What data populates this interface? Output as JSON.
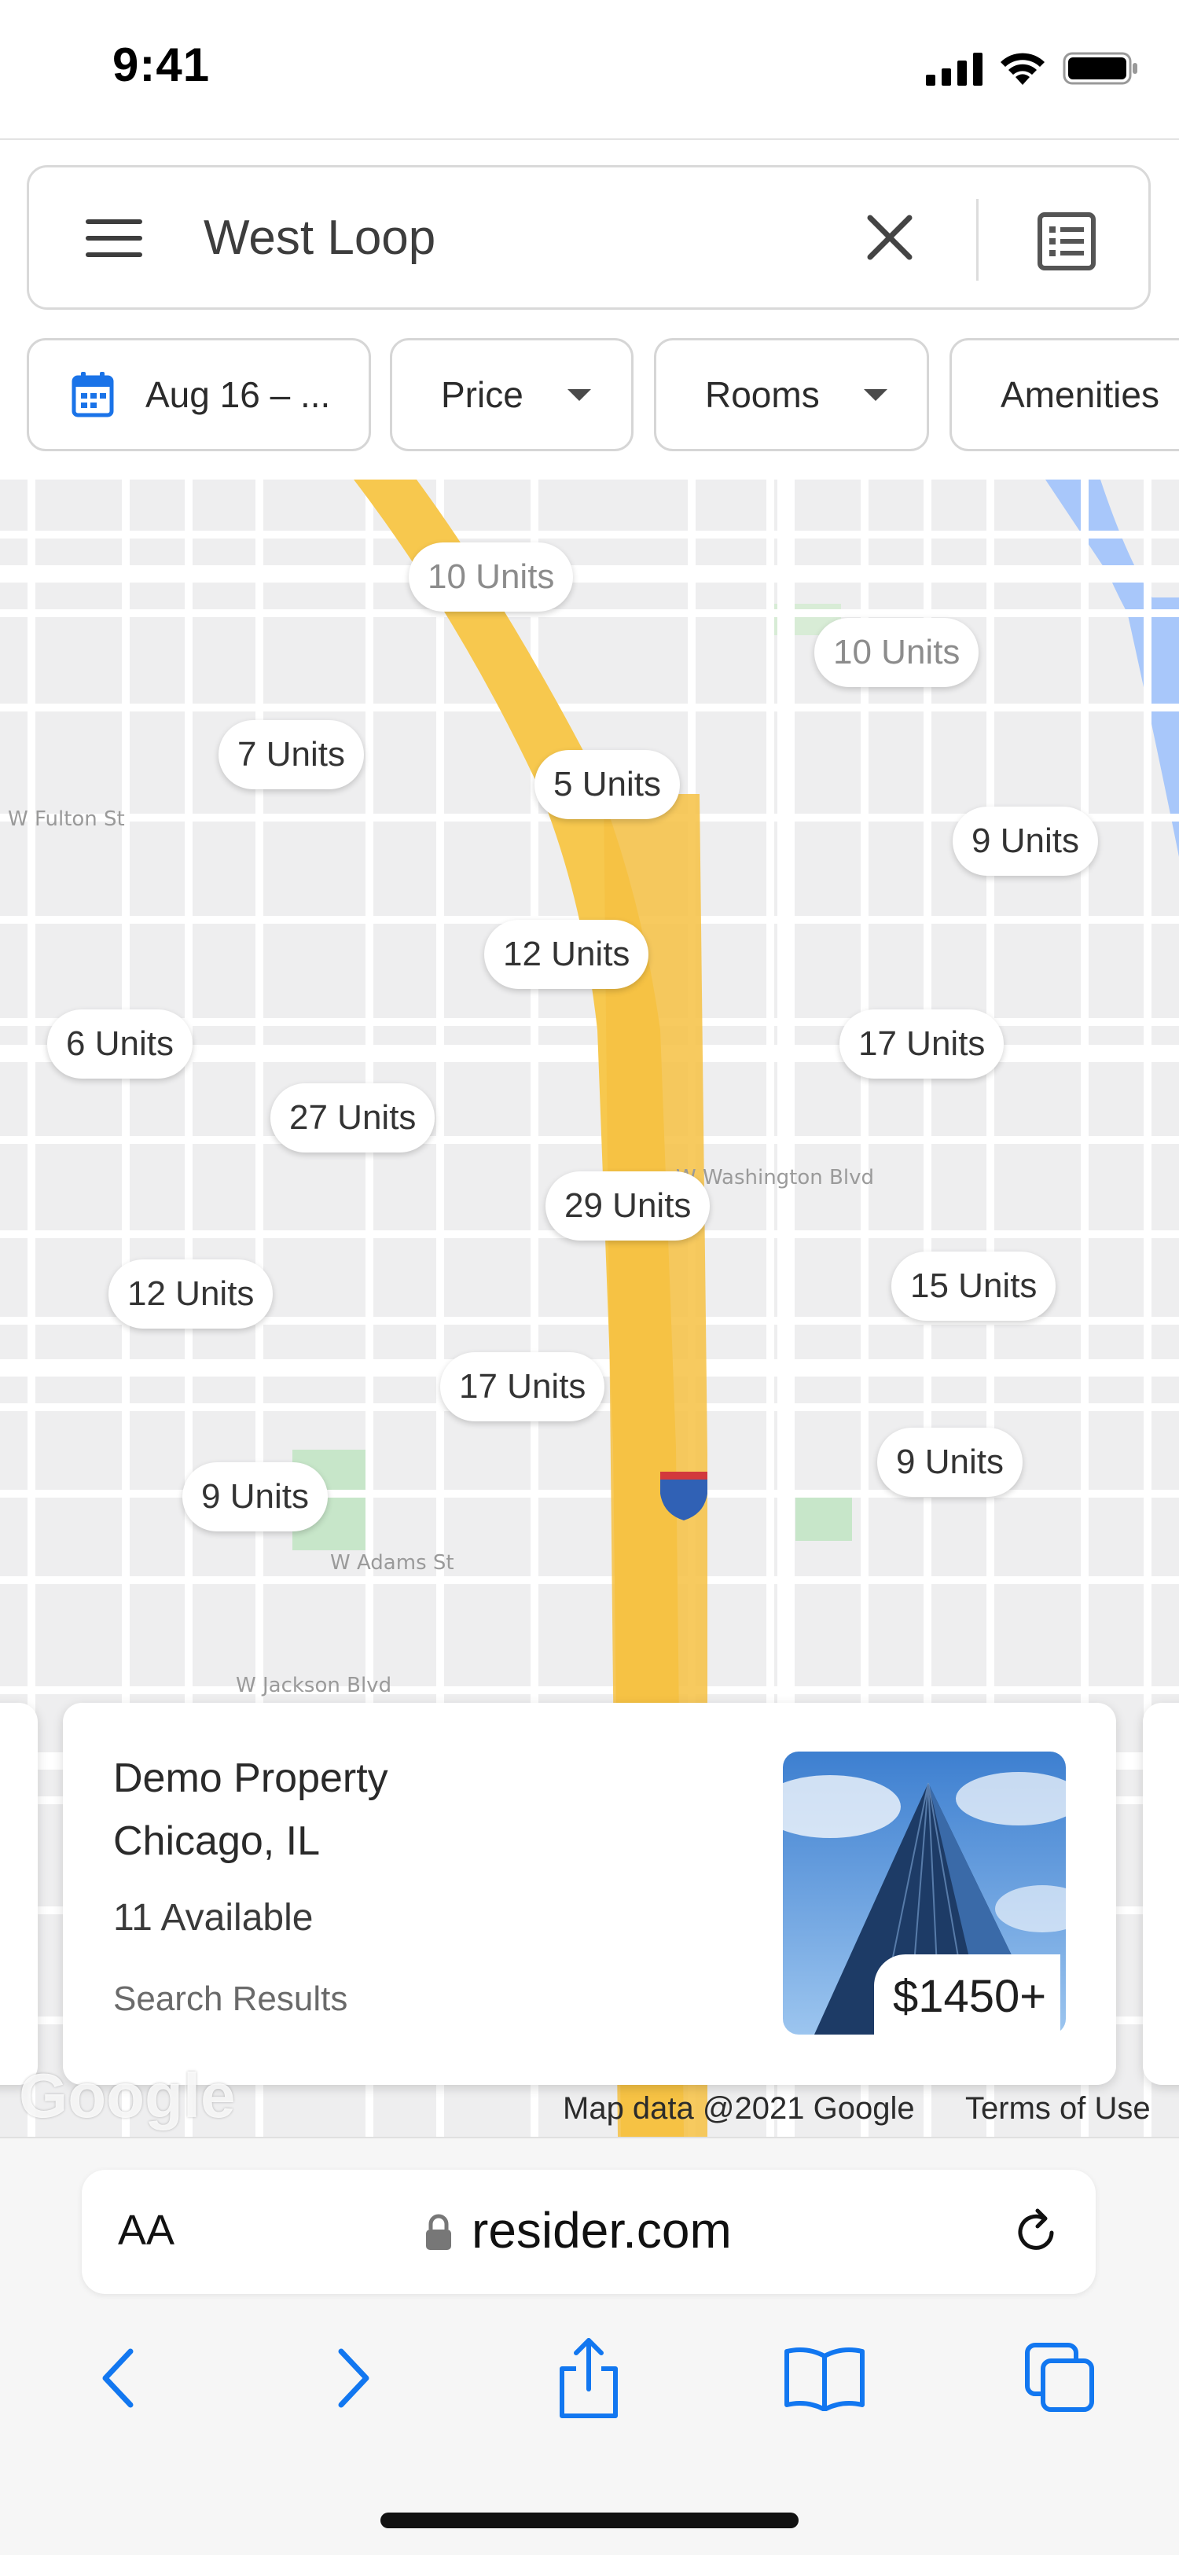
{
  "status_bar": {
    "time": "9:41"
  },
  "search": {
    "query": "West Loop"
  },
  "filters": [
    {
      "label": "Aug 16 – ..."
    },
    {
      "label": "Price"
    },
    {
      "label": "Rooms"
    },
    {
      "label": "Amenities"
    }
  ],
  "map": {
    "markers": [
      {
        "label": "10 Units",
        "dim": true
      },
      {
        "label": "10 Units",
        "dim": true
      },
      {
        "label": "7 Units"
      },
      {
        "label": "5 Units"
      },
      {
        "label": "9 Units"
      },
      {
        "label": "12 Units"
      },
      {
        "label": "6 Units"
      },
      {
        "label": "17 Units"
      },
      {
        "label": "27 Units"
      },
      {
        "label": "29 Units"
      },
      {
        "label": "12 Units"
      },
      {
        "label": "15 Units"
      },
      {
        "label": "17 Units"
      },
      {
        "label": "9 Units"
      },
      {
        "label": "9 Units"
      }
    ],
    "street_labels": [
      "W Fulton St",
      "W Washington Blvd",
      "W Adams St",
      "W Jackson Blvd"
    ],
    "attribution": "Map data @2021 Google",
    "terms": "Terms of Use",
    "logo_text": "Google"
  },
  "property_card": {
    "name": "Demo Property",
    "city": "Chicago, IL",
    "availability": "11 Available",
    "source": "Search Results",
    "price": "$1450+"
  },
  "browser": {
    "text_size_label": "AA",
    "domain": "resider.com"
  },
  "colors": {
    "accent": "#1a73e8",
    "ios_blue": "#1277f0",
    "highway": "#f6c143",
    "map_bg": "#eeeeef"
  }
}
